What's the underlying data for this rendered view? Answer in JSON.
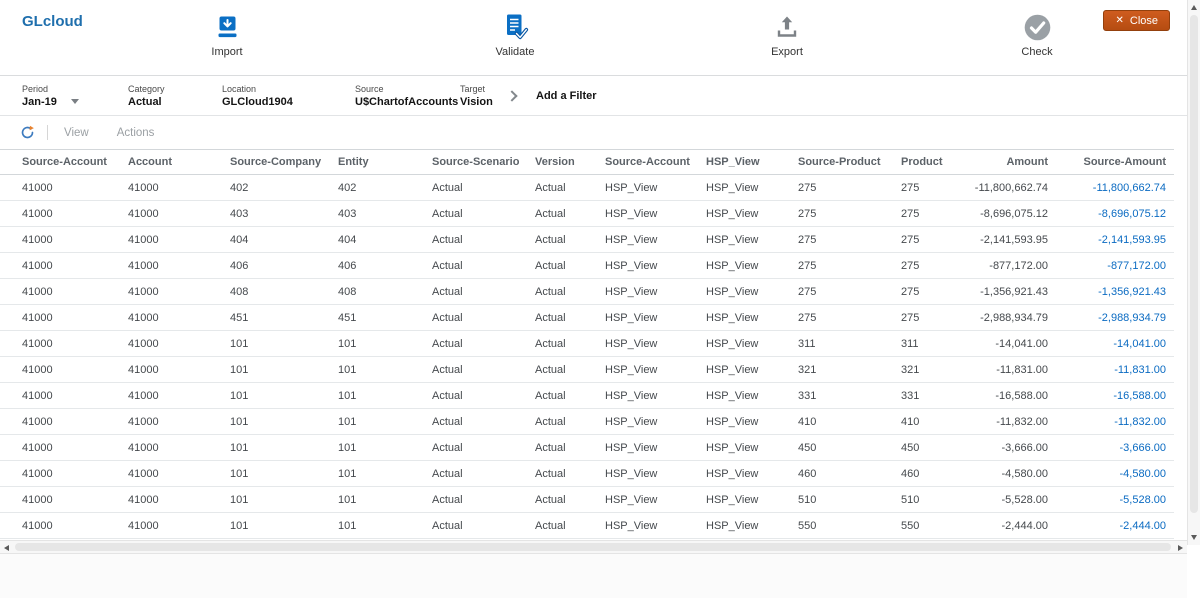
{
  "header": {
    "title": "GLcloud",
    "actions": {
      "import": {
        "label": "Import"
      },
      "validate": {
        "label": "Validate"
      },
      "export": {
        "label": "Export"
      },
      "check": {
        "label": "Check"
      }
    },
    "close": {
      "label": "Close",
      "icon": "✕"
    }
  },
  "pov": {
    "fields": [
      {
        "label": "Period",
        "value": "Jan-19"
      },
      {
        "label": "Category",
        "value": "Actual"
      },
      {
        "label": "Location",
        "value": "GLCloud1904"
      },
      {
        "label": "Source",
        "value": "U$ChartofAccounts"
      },
      {
        "label": "Target",
        "value": "Vision"
      }
    ],
    "add_filter": "Add a Filter"
  },
  "grid_toolbar": {
    "view": "View",
    "actions": "Actions"
  },
  "table": {
    "columns": [
      "Source-Account",
      "Account",
      "Source-Company",
      "Entity",
      "Source-Scenario",
      "Version",
      "Source-Account",
      "HSP_View",
      "Source-Product",
      "Product",
      "Amount",
      "Source-Amount"
    ],
    "rows": [
      [
        "41000",
        "41000",
        "402",
        "402",
        "Actual",
        "Actual",
        "HSP_View",
        "HSP_View",
        "275",
        "275",
        "-11,800,662.74",
        "-11,800,662.74"
      ],
      [
        "41000",
        "41000",
        "403",
        "403",
        "Actual",
        "Actual",
        "HSP_View",
        "HSP_View",
        "275",
        "275",
        "-8,696,075.12",
        "-8,696,075.12"
      ],
      [
        "41000",
        "41000",
        "404",
        "404",
        "Actual",
        "Actual",
        "HSP_View",
        "HSP_View",
        "275",
        "275",
        "-2,141,593.95",
        "-2,141,593.95"
      ],
      [
        "41000",
        "41000",
        "406",
        "406",
        "Actual",
        "Actual",
        "HSP_View",
        "HSP_View",
        "275",
        "275",
        "-877,172.00",
        "-877,172.00"
      ],
      [
        "41000",
        "41000",
        "408",
        "408",
        "Actual",
        "Actual",
        "HSP_View",
        "HSP_View",
        "275",
        "275",
        "-1,356,921.43",
        "-1,356,921.43"
      ],
      [
        "41000",
        "41000",
        "451",
        "451",
        "Actual",
        "Actual",
        "HSP_View",
        "HSP_View",
        "275",
        "275",
        "-2,988,934.79",
        "-2,988,934.79"
      ],
      [
        "41000",
        "41000",
        "101",
        "101",
        "Actual",
        "Actual",
        "HSP_View",
        "HSP_View",
        "311",
        "311",
        "-14,041.00",
        "-14,041.00"
      ],
      [
        "41000",
        "41000",
        "101",
        "101",
        "Actual",
        "Actual",
        "HSP_View",
        "HSP_View",
        "321",
        "321",
        "-11,831.00",
        "-11,831.00"
      ],
      [
        "41000",
        "41000",
        "101",
        "101",
        "Actual",
        "Actual",
        "HSP_View",
        "HSP_View",
        "331",
        "331",
        "-16,588.00",
        "-16,588.00"
      ],
      [
        "41000",
        "41000",
        "101",
        "101",
        "Actual",
        "Actual",
        "HSP_View",
        "HSP_View",
        "410",
        "410",
        "-11,832.00",
        "-11,832.00"
      ],
      [
        "41000",
        "41000",
        "101",
        "101",
        "Actual",
        "Actual",
        "HSP_View",
        "HSP_View",
        "450",
        "450",
        "-3,666.00",
        "-3,666.00"
      ],
      [
        "41000",
        "41000",
        "101",
        "101",
        "Actual",
        "Actual",
        "HSP_View",
        "HSP_View",
        "460",
        "460",
        "-4,580.00",
        "-4,580.00"
      ],
      [
        "41000",
        "41000",
        "101",
        "101",
        "Actual",
        "Actual",
        "HSP_View",
        "HSP_View",
        "510",
        "510",
        "-5,528.00",
        "-5,528.00"
      ],
      [
        "41000",
        "41000",
        "101",
        "101",
        "Actual",
        "Actual",
        "HSP_View",
        "HSP_View",
        "550",
        "550",
        "-2,444.00",
        "-2,444.00"
      ]
    ]
  },
  "colors": {
    "title_blue": "#1f6fad",
    "accent_blue": "#0b6fc4",
    "close_button_orange": "#c2541a",
    "source_amount_link": "#0b6bc2",
    "icon_gray": "#8a8f94"
  }
}
